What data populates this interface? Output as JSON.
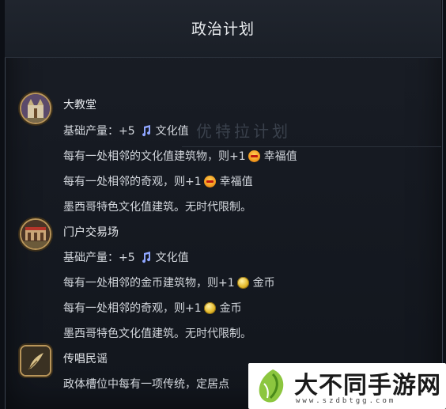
{
  "title": "政治计划",
  "ghost_text": "优特拉计划",
  "items": [
    {
      "name": "大教堂",
      "lines": [
        {
          "prefix": "基础产量：+5",
          "icon": "culture-music-icon",
          "suffix": "文化值"
        },
        {
          "prefix": "每有一处相邻的文化值建筑物，则+1",
          "icon": "happiness-icon",
          "suffix": "幸福值"
        },
        {
          "prefix": "每有一处相邻的奇观，则+1",
          "icon": "happiness-icon",
          "suffix": "幸福值"
        },
        {
          "prefix": "墨西哥特色文化值建筑。无时代限制。"
        }
      ]
    },
    {
      "name": "门户交易场",
      "lines": [
        {
          "prefix": "基础产量：+5",
          "icon": "culture-music-icon",
          "suffix": "文化值"
        },
        {
          "prefix": "每有一处相邻的金币建筑物，则+1",
          "icon": "gold-coin-icon",
          "suffix": "金币"
        },
        {
          "prefix": "每有一处相邻的奇观，则+1",
          "icon": "gold-coin-icon",
          "suffix": "金币"
        },
        {
          "prefix": "墨西哥特色文化值建筑。无时代限制。"
        }
      ]
    },
    {
      "name": "传唱民谣",
      "lines": [
        {
          "prefix": "政体槽位中每有一项传统，定居点"
        }
      ]
    }
  ],
  "watermark": {
    "text": "大不同手游网",
    "url": "www.szdbtgg.com"
  },
  "colors": {
    "panel_bg": "#161a22",
    "text": "#d3d7dd",
    "icon_border": "#b8955a",
    "culture_blue": "#8fa6ff"
  }
}
